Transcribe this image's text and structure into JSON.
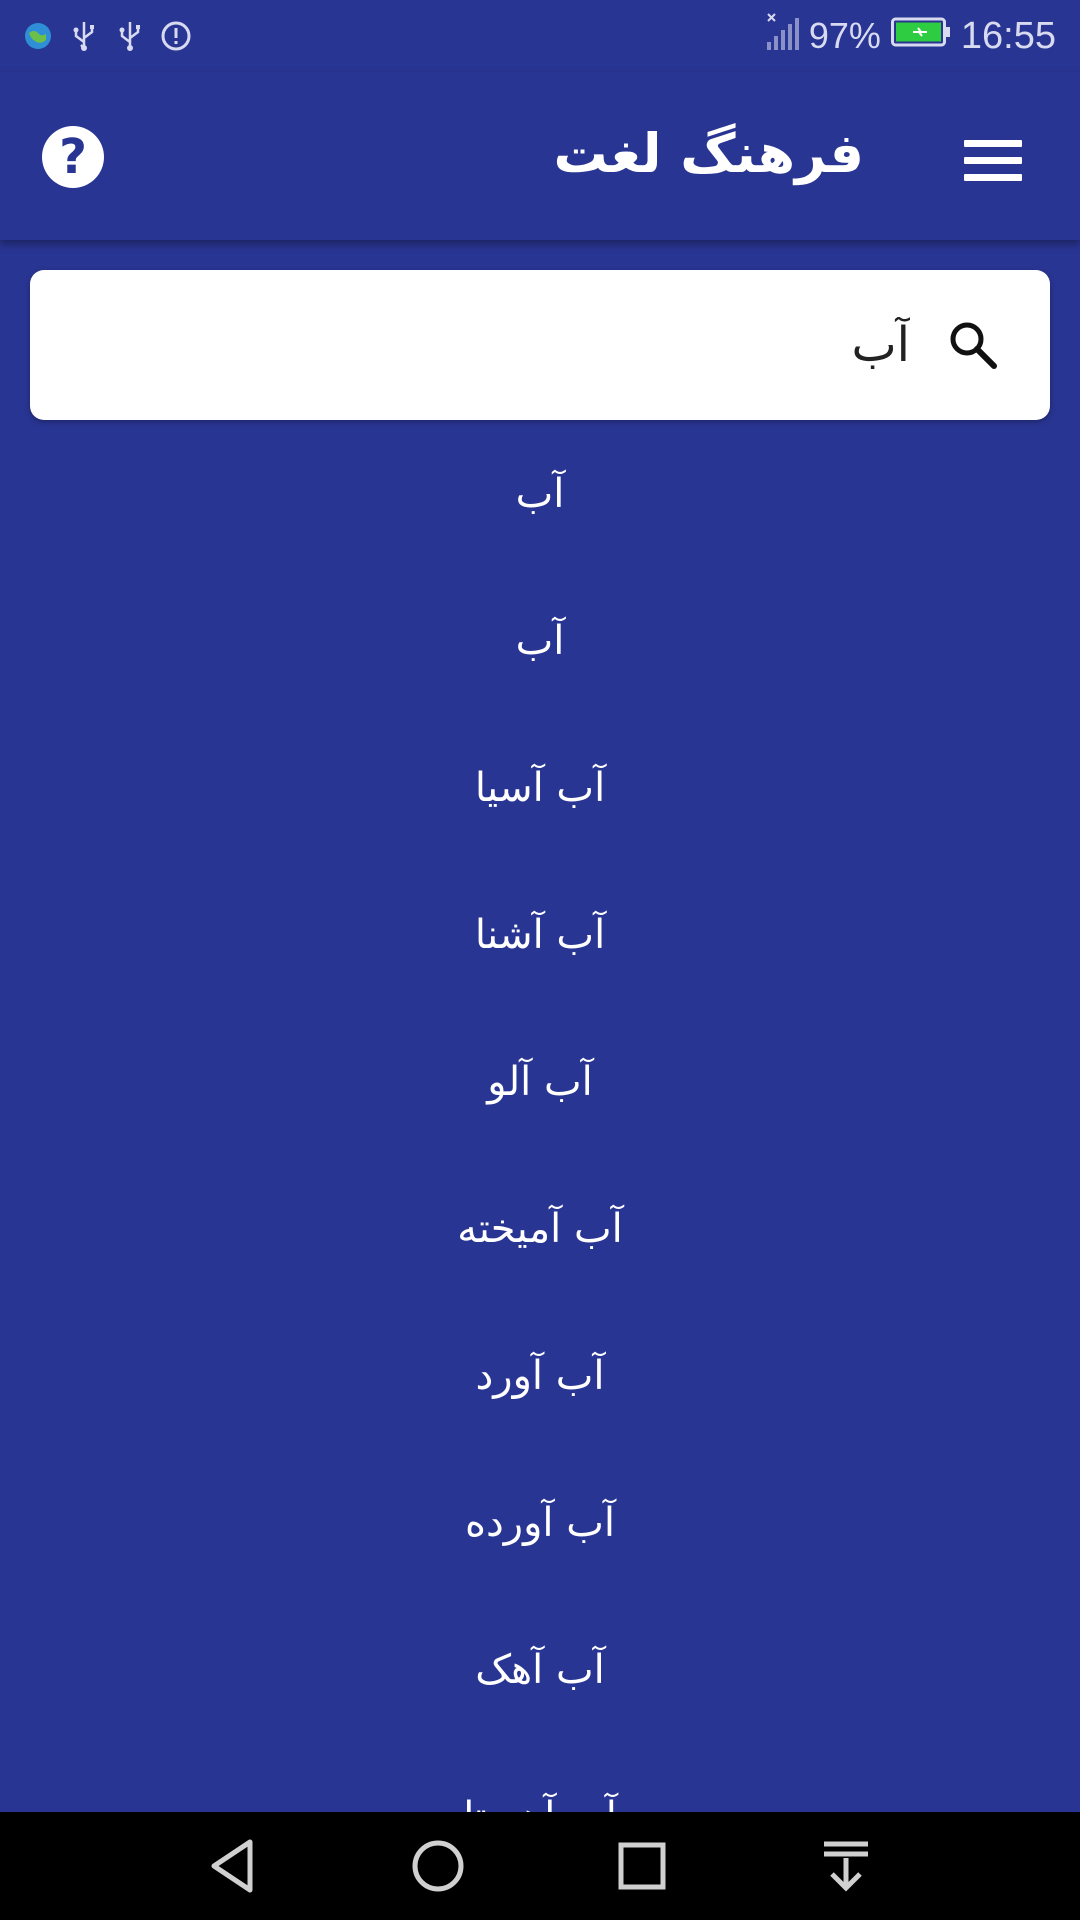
{
  "status_bar": {
    "battery_percent": "97%",
    "time": "16:55"
  },
  "app_bar": {
    "title": "فرهنگ لغت"
  },
  "search": {
    "value": "آب"
  },
  "results": [
    "آب",
    "آب",
    "آب آسیا",
    "آب آشنا",
    "آب آلو",
    "آب آمیخته",
    "آب آورد",
    "آب آورده",
    "آب آهک",
    "آب آهستا"
  ],
  "colors": {
    "primary": "#293593",
    "battery": "#2ecc40"
  }
}
